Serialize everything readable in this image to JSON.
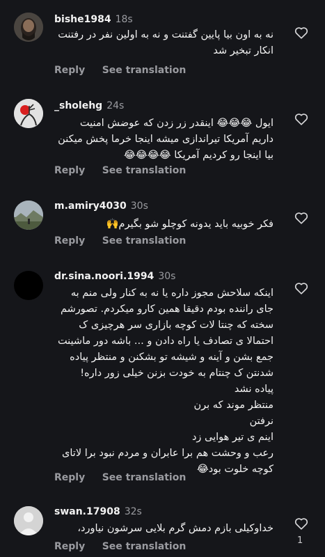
{
  "comments": [
    {
      "username": "bishe1984",
      "time": "18s",
      "lines": [
        "نه به اون بیا پایین گفتنت و نه به اولین نفر در رفتنت",
        "انکار تبخیر شد"
      ],
      "reply_label": "Reply",
      "translate_label": "See translation"
    },
    {
      "username": "_sholehg",
      "time": "24s",
      "lines": [
        "ایول 😂😂😂 اینقدر زر زدن که عوضش امنیت",
        "داریم آمریکا تیراندازی میشه  اینجا خرما پخش میکنن",
        "بیا اینجا رو کردیم آمریکا 😂😂😂😂"
      ],
      "reply_label": "Reply",
      "translate_label": "See translation"
    },
    {
      "username": "m.amiry4030",
      "time": "30s",
      "lines": [
        "فکر خوبیه باید یدونه کوچلو شو بگیرم🙌"
      ],
      "reply_label": "Reply",
      "translate_label": "See translation"
    },
    {
      "username": "dr.sina.noori.1994",
      "time": "30s",
      "lines": [
        "اینکه سلاحش مجوز داره یا نه به کنار ولی منم به",
        "جای راننده بودم دقیقا همین کارو میکردم. تصورشم",
        "سخته که چنتا لات کوچه بازاری سر هرچیزی ک",
        "احتمالا ی تصادف یا راه دادن و ... باشه دور ماشینت",
        "جمع بشن و آینه و شیشه تو بشکنن و منتظر پیاده",
        "شدنتن ک چنتام به خودت بزنن خیلی زور داره!",
        "پیاده نشد",
        "منتظر موند که برن",
        "نرفتن",
        "اینم ی تیر هوایی زد",
        "رعب و وحشت هم برا عابران و مردم نبود برا لاتای",
        "کوچه خلوت بود😂"
      ],
      "reply_label": "Reply",
      "translate_label": "See translation"
    },
    {
      "username": "swan.17908",
      "time": "32s",
      "lines": [
        "خداوکیلی بازم دمش گرم بلایی سرشون نیاورد،"
      ],
      "reply_label": "Reply",
      "translate_label": "See translation",
      "like_count": "1"
    }
  ]
}
